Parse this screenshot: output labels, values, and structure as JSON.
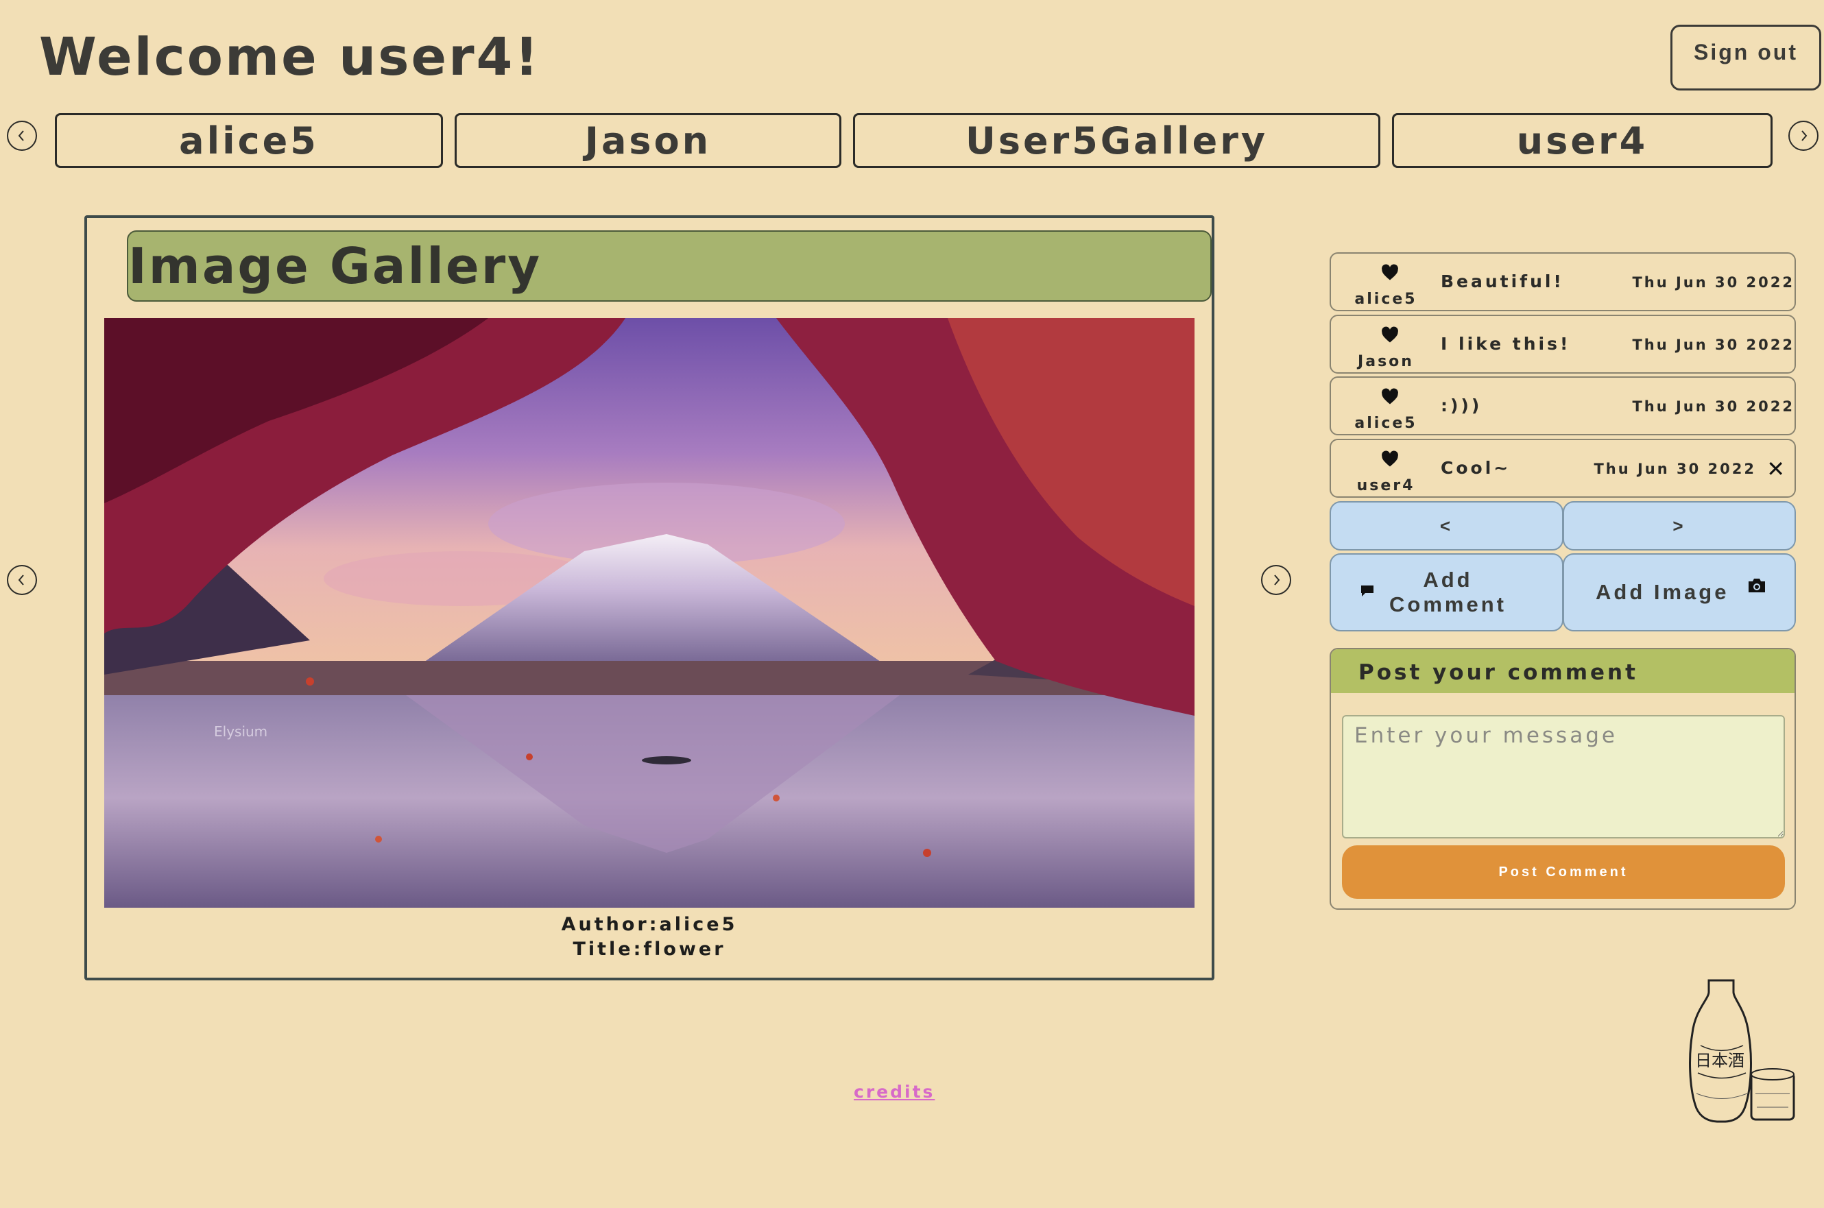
{
  "header": {
    "welcome": "Welcome user4!",
    "signout_label": "Sign out"
  },
  "user_tabs": [
    {
      "label": "alice5"
    },
    {
      "label": "Jason"
    },
    {
      "label": "User5Gallery"
    },
    {
      "label": "user4"
    }
  ],
  "gallery": {
    "title": "Image Gallery",
    "author": "Author:alice5",
    "image_title": "Title:flower",
    "watermark": "Elysium"
  },
  "comments": [
    {
      "author": "alice5",
      "text": "Beautiful!",
      "date": "Thu Jun 30 2022",
      "deletable": false
    },
    {
      "author": "Jason",
      "text": "I like this!",
      "date": "Thu Jun 30 2022",
      "deletable": false
    },
    {
      "author": "alice5",
      "text": ":)))",
      "date": "Thu Jun 30 2022",
      "deletable": false
    },
    {
      "author": "user4",
      "text": "Cool~",
      "date": "Thu Jun 30 2022",
      "deletable": true
    }
  ],
  "pager": {
    "prev_label": "<",
    "next_label": ">"
  },
  "actions": {
    "add_comment_line1": "Add",
    "add_comment_line2": "Comment",
    "add_image_label": "Add Image"
  },
  "post_form": {
    "header": "Post your comment",
    "placeholder": "Enter your message",
    "button_label": "Post Comment"
  },
  "footer": {
    "credits": "credits"
  },
  "sake_label": "日本酒",
  "colors": {
    "background": "#f2dfb6",
    "title_bar": "#a7b46f",
    "post_header": "#b3c064",
    "blue_button": "#c4dcf2",
    "post_button": "#e0923a",
    "credits_link": "#d76ac8"
  }
}
